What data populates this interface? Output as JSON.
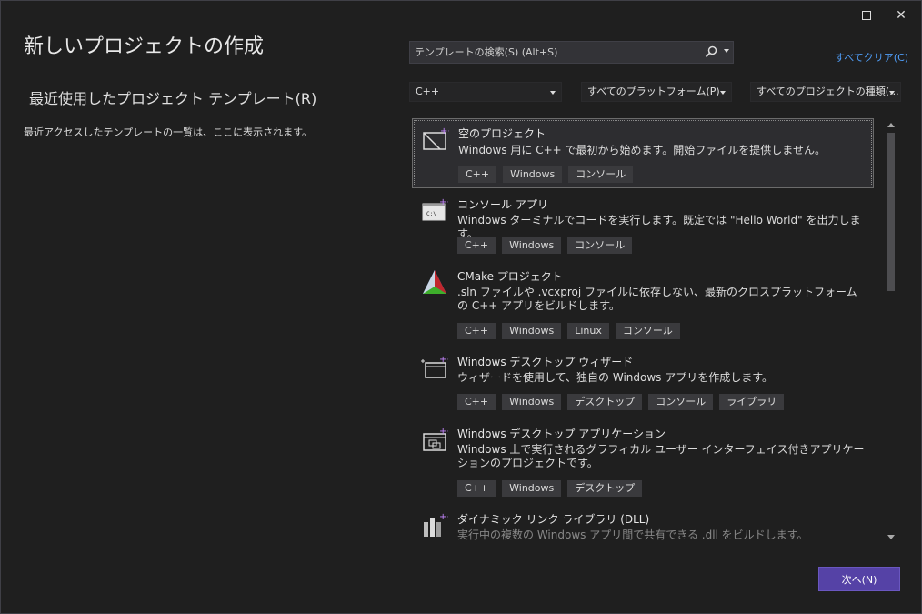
{
  "window": {
    "maximize_icon": "maximize-icon",
    "close_icon": "close-icon",
    "close_glyph": "✕"
  },
  "page": {
    "title": "新しいプロジェクトの作成",
    "recent_heading": "最近使用したプロジェクト テンプレート(R)",
    "recent_desc": "最近アクセスしたテンプレートの一覧は、ここに表示されます。"
  },
  "search": {
    "placeholder": "テンプレートの検索(S) (Alt+S)",
    "icon": "search-icon"
  },
  "clear_all": "すべてクリア(C)",
  "filters": {
    "language": "C++",
    "platform": "すべてのプラットフォーム(P)",
    "project_type": "すべてのプロジェクトの種類(..."
  },
  "templates": [
    {
      "name": "空のプロジェクト",
      "desc": "Windows 用に C++ で最初から始めます。開始ファイルを提供しません。",
      "tags": [
        "C++",
        "Windows",
        "コンソール"
      ]
    },
    {
      "name": "コンソール アプリ",
      "desc": "Windows ターミナルでコードを実行します。既定では \"Hello World\" を出力します。",
      "tags": [
        "C++",
        "Windows",
        "コンソール"
      ]
    },
    {
      "name": "CMake プロジェクト",
      "desc": ".sln ファイルや .vcxproj ファイルに依存しない、最新のクロスプラットフォームの C++ アプリをビルドします。",
      "tags": [
        "C++",
        "Windows",
        "Linux",
        "コンソール"
      ]
    },
    {
      "name": "Windows デスクトップ ウィザード",
      "desc": "ウィザードを使用して、独自の Windows アプリを作成します。",
      "tags": [
        "C++",
        "Windows",
        "デスクトップ",
        "コンソール",
        "ライブラリ"
      ]
    },
    {
      "name": "Windows デスクトップ アプリケーション",
      "desc": "Windows 上で実行されるグラフィカル ユーザー インターフェイス付きアプリケーションのプロジェクトです。",
      "tags": [
        "C++",
        "Windows",
        "デスクトップ"
      ]
    },
    {
      "name": "ダイナミック リンク ライブラリ (DLL)",
      "desc": "実行中の複数の Windows アプリ間で共有できる .dll をビルドします。",
      "tags": []
    }
  ],
  "next_button": "次へ(N)",
  "colors": {
    "accent": "#5542a6",
    "link": "#4f9cf5",
    "background": "#1f1f1f"
  }
}
